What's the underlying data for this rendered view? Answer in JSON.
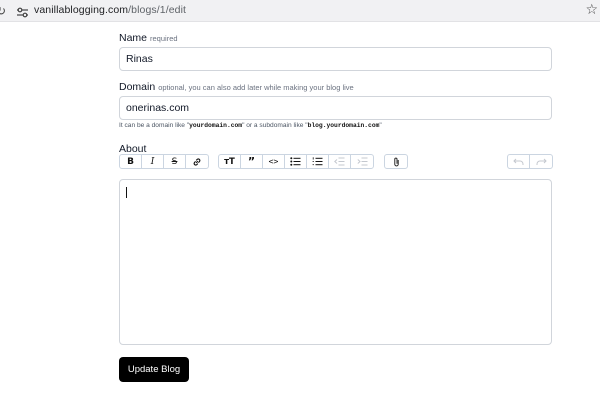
{
  "browser": {
    "url_domain": "vanillablogging.com",
    "url_path": "/blogs/1/edit"
  },
  "form": {
    "name": {
      "label": "Name",
      "hint": "required",
      "value": "Rinas"
    },
    "domain": {
      "label": "Domain",
      "hint": "optional, you can also add later while making your blog live",
      "value": "onerinas.com",
      "help_prefix": "It can be a domain like \"",
      "help_example1": "yourdomain.com",
      "help_middle": "\" or a subdomain like \"",
      "help_example2": "blog.yourdomain.com",
      "help_suffix": "\""
    },
    "about": {
      "label": "About",
      "content": ""
    },
    "toolbar": {
      "bold": "B",
      "italic": "I",
      "strike": "S",
      "heading": "тT",
      "quote": "”",
      "code": "<>"
    },
    "submit_label": "Update Blog"
  },
  "icons": {
    "reload": "reload-icon",
    "site_info": "tune-icon",
    "star": "star-icon"
  }
}
